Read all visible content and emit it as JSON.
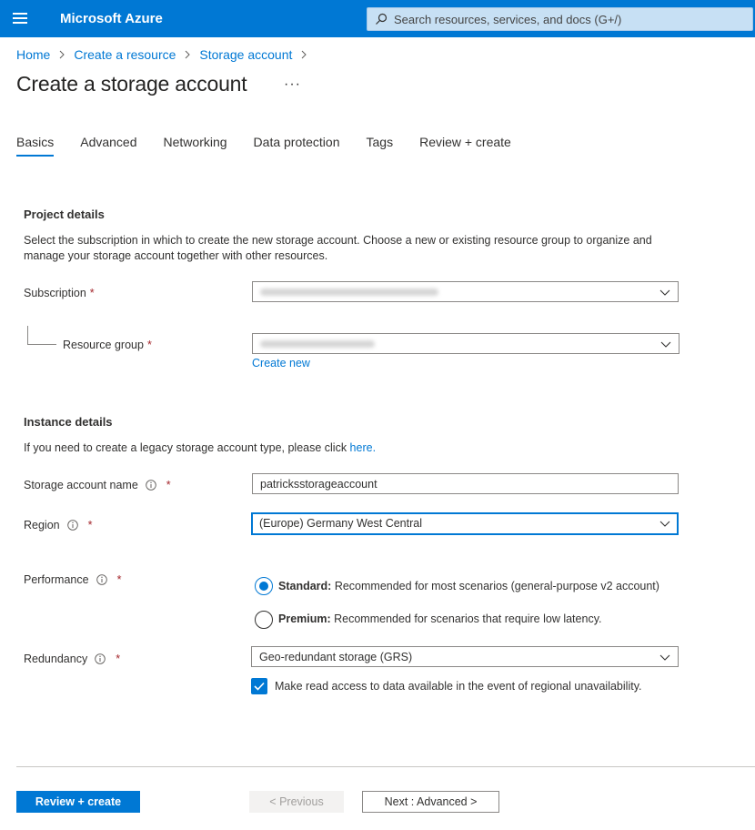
{
  "header": {
    "brand": "Microsoft Azure",
    "search_placeholder": "Search resources, services, and docs (G+/)"
  },
  "breadcrumb": [
    "Home",
    "Create a resource",
    "Storage account"
  ],
  "page": {
    "title": "Create a storage account",
    "more": "···"
  },
  "tabs": [
    {
      "label": "Basics",
      "active": true
    },
    {
      "label": "Advanced"
    },
    {
      "label": "Networking"
    },
    {
      "label": "Data protection"
    },
    {
      "label": "Tags"
    },
    {
      "label": "Review + create"
    }
  ],
  "project": {
    "title": "Project details",
    "description": "Select the subscription in which to create the new storage account. Choose a new or existing resource group to organize and manage your storage account together with other resources.",
    "subscription_label": "Subscription",
    "resource_group_label": "Resource group",
    "create_new": "Create new",
    "required_mark": "*"
  },
  "instance": {
    "title": "Instance details",
    "description_prefix": "If you need to create a legacy storage account type, please click ",
    "description_link": "here.",
    "name_label": "Storage account name",
    "name_value": "patricksstorageaccount",
    "region_label": "Region",
    "region_value": "(Europe) Germany West Central",
    "performance_label": "Performance",
    "standard_title": "Standard:",
    "standard_desc": " Recommended for most scenarios (general-purpose v2 account)",
    "premium_title": "Premium:",
    "premium_desc": " Recommended for scenarios that require low latency.",
    "redundancy_label": "Redundancy",
    "redundancy_value": "Geo-redundant storage (GRS)",
    "read_access_label": "Make read access to data available in the event of regional unavailability."
  },
  "footer": {
    "review_create": "Review + create",
    "previous": "< Previous",
    "next": "Next : Advanced >"
  },
  "colors": {
    "accent": "#0078d4",
    "required": "#a4262c"
  }
}
